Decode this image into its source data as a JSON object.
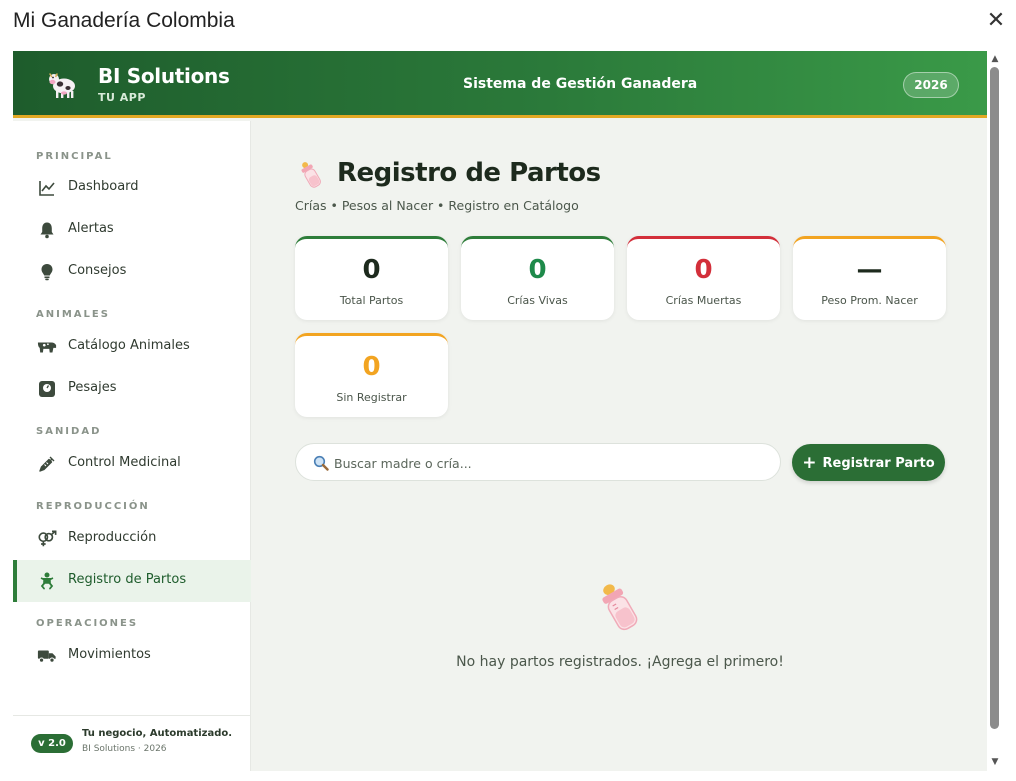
{
  "window": {
    "title": "Mi Ganadería Colombia",
    "close_glyph": "✕"
  },
  "header": {
    "brand_name": "BI Solutions",
    "brand_sub": "TU APP",
    "center_title": "Sistema de Gestión Ganadera",
    "year": "2026",
    "logo_icon": "cow-icon",
    "colors": {
      "header_start": "#1e5c2c",
      "header_end": "#3a9a48",
      "accent_border": "#e2a823"
    }
  },
  "sidebar": {
    "sections": [
      {
        "label": "PRINCIPAL",
        "items": [
          {
            "label": "Dashboard",
            "icon": "chart-line-icon"
          },
          {
            "label": "Alertas",
            "icon": "bell-icon"
          },
          {
            "label": "Consejos",
            "icon": "lightbulb-icon"
          }
        ]
      },
      {
        "label": "ANIMALES",
        "items": [
          {
            "label": "Catálogo Animales",
            "icon": "cow-icon"
          },
          {
            "label": "Pesajes",
            "icon": "scale-icon"
          }
        ]
      },
      {
        "label": "SANIDAD",
        "items": [
          {
            "label": "Control Medicinal",
            "icon": "syringe-icon"
          }
        ]
      },
      {
        "label": "REPRODUCCIÓN",
        "items": [
          {
            "label": "Reproducción",
            "icon": "gender-icon"
          },
          {
            "label": "Registro de Partos",
            "icon": "baby-icon",
            "active": true
          }
        ]
      },
      {
        "label": "OPERACIONES",
        "items": [
          {
            "label": "Movimientos",
            "icon": "truck-icon"
          }
        ]
      }
    ],
    "footer": {
      "version": "v 2.0",
      "tagline": "Tu negocio, Automatizado.",
      "copyright": "BI Solutions · 2026"
    }
  },
  "main": {
    "title": "Registro de Partos",
    "subtitle": "Crías • Pesos al Nacer • Registro en Catálogo",
    "title_icon": "baby-bottle-icon",
    "stats": [
      {
        "value": "0",
        "label": "Total Partos",
        "color": "#1d2a1d",
        "border": "#2e7d3a"
      },
      {
        "value": "0",
        "label": "Crías Vivas",
        "color": "#1e8a4a",
        "border": "#2e7d3a"
      },
      {
        "value": "0",
        "label": "Crías Muertas",
        "color": "#d32f3a",
        "border": "#d32f3a"
      },
      {
        "value": "—",
        "label": "Peso Prom. Nacer",
        "color": "#1d2a1d",
        "border": "#f2a421"
      },
      {
        "value": "0",
        "label": "Sin Registrar",
        "color": "#f2a421",
        "border": "#f2a421"
      }
    ],
    "search": {
      "placeholder": "Buscar madre o cría...",
      "value": "",
      "icon": "search-icon"
    },
    "add_button": {
      "label": "Registrar Parto",
      "icon": "plus-icon"
    },
    "empty_state": {
      "icon": "baby-bottle-icon",
      "text": "No hay partos registrados. ¡Agrega el primero!"
    }
  }
}
